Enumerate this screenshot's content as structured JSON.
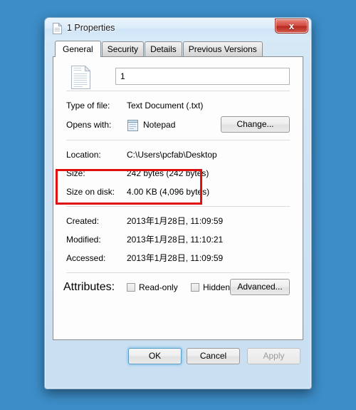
{
  "window": {
    "title": "1 Properties",
    "title_icon": "text-document-icon",
    "close_label": "x"
  },
  "tabs": [
    {
      "label": "General",
      "active": true
    },
    {
      "label": "Security",
      "active": false
    },
    {
      "label": "Details",
      "active": false
    },
    {
      "label": "Previous Versions",
      "active": false
    }
  ],
  "general": {
    "file_icon": "text-document-icon",
    "filename_value": "1",
    "type_of_file": {
      "label": "Type of file:",
      "value": "Text Document (.txt)"
    },
    "opens_with": {
      "label": "Opens with:",
      "value": "Notepad",
      "icon": "notepad-icon",
      "change_button": "Change..."
    },
    "location": {
      "label": "Location:",
      "value": "C:\\Users\\pcfab\\Desktop"
    },
    "size": {
      "label": "Size:",
      "value": "242 bytes (242 bytes)"
    },
    "size_on_disk": {
      "label": "Size on disk:",
      "value": "4.00 KB (4,096 bytes)"
    },
    "created": {
      "label": "Created:",
      "value": "2013年1月28日, 11:09:59"
    },
    "modified": {
      "label": "Modified:",
      "value": "2013年1月28日, 11:10:21"
    },
    "accessed": {
      "label": "Accessed:",
      "value": "2013年1月28日, 11:09:59"
    },
    "attributes": {
      "label": "Attributes:",
      "read_only": {
        "label": "Read-only",
        "checked": false
      },
      "hidden": {
        "label": "Hidden",
        "checked": false
      },
      "advanced_button": "Advanced..."
    }
  },
  "footer": {
    "ok": "OK",
    "cancel": "Cancel",
    "apply": "Apply"
  },
  "annotation": {
    "highlight_color": "#e01010",
    "highlights": "size-and-size-on-disk"
  }
}
